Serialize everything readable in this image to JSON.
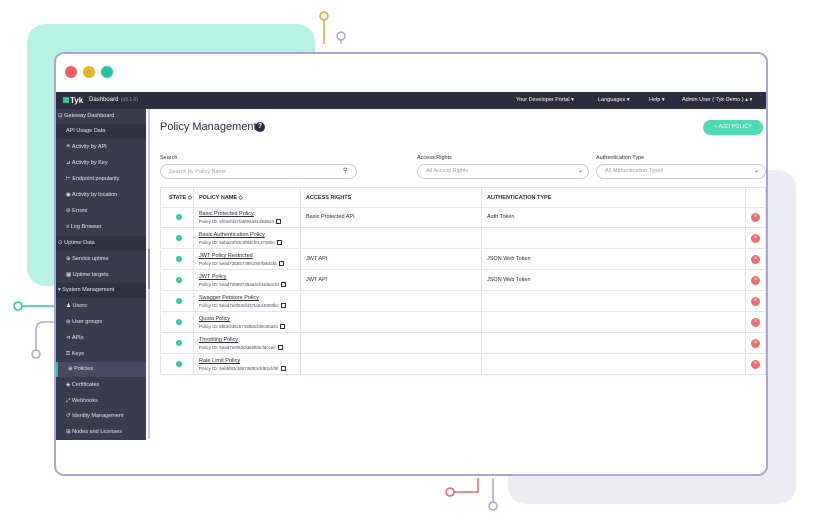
{
  "topbar": {
    "logo": "Tyk",
    "app_name": "Dashboard",
    "version": "(v3.1.0)",
    "nav": [
      "Your Developer Portal ▾",
      "Languages ▾",
      "Help ▾",
      "Admin User ( Tyk Demo ) ▴ ▾"
    ]
  },
  "sidebar": {
    "items": [
      {
        "label": "⊡ Gateway Dashboard"
      },
      {
        "label": "API Usage Data"
      },
      {
        "label": "≗ Activity by API"
      },
      {
        "label": "⊿ Activity by Key"
      },
      {
        "label": "⊢ Endpoint popularity"
      },
      {
        "label": "◉ Activity by location"
      },
      {
        "label": "⊘ Errors"
      },
      {
        "label": "≡ Log Browser"
      },
      {
        "label": "⊙ Uptime Data"
      },
      {
        "label": "⊕ Service uptime"
      },
      {
        "label": "▦ Uptime targets"
      },
      {
        "label": "▾ System Management"
      },
      {
        "label": "♟ Users"
      },
      {
        "label": "⊛ User groups"
      },
      {
        "label": "⊲ APIs"
      },
      {
        "label": "⚿ Keys"
      },
      {
        "label": "⊕ Policies"
      },
      {
        "label": "◈ Certificates"
      },
      {
        "label": "⤢ Webhooks"
      },
      {
        "label": "↺ Identity Management"
      },
      {
        "label": "⊞ Nodes and Licenses"
      }
    ]
  },
  "main": {
    "title": "Policy Management",
    "help": "?",
    "add_button": "+ ADD POLICY",
    "filters": {
      "search_label": "Search",
      "search_placeholder": "Search by Policy Name",
      "access_label": "Access Rights",
      "access_value": "All Access Rights",
      "auth_label": "Authentication Type",
      "auth_value": "All Authentication Types"
    },
    "table": {
      "headers": [
        "STATE ◇",
        "POLICY NAME ◇",
        "ACCESS RIGHTS",
        "AUTHENTICATION TYPE"
      ],
      "rows": [
        {
          "name": "Basic Protected Policy",
          "id": "Policy ID: 5f03cfd37fa5f92a91d5d824",
          "rights": "Basic Protected API",
          "auth": "Auth Token"
        },
        {
          "name": "Basic Authentication Policy",
          "id": "Policy ID: 5eba22f83c0f83cf0137385c",
          "rights": "",
          "auth": ""
        },
        {
          "name": "JWT Policy Restricted",
          "id": "Policy ID: 5ead7356573961000fa63cfd",
          "rights": "JWT API",
          "auth": "JSON Web Token"
        },
        {
          "name": "JWT Policy",
          "id": "Policy ID: 5ead72955735aa3cfd4d63cfd",
          "rights": "JWT API",
          "auth": "JSON Web Token"
        },
        {
          "name": "Swagger Petstore Policy",
          "id": "Policy ID: 5ead7e5f83cfd37fa5d4000fbc",
          "rights": "",
          "auth": ""
        },
        {
          "name": "Quota Policy",
          "id": "Policy ID: 5f83cfd5c5735f83cfd8c8ba81",
          "rights": "",
          "auth": ""
        },
        {
          "name": "Throttling Policy",
          "id": "Policy ID: 5ead7e5f83cfde5f83cfdccee",
          "rights": "",
          "auth": ""
        },
        {
          "name": "Rate Limit Policy",
          "id": "Policy ID: 5eb5f83cfd5735f83cfd83cfd5f",
          "rights": "",
          "auth": ""
        }
      ]
    }
  },
  "colors": {
    "accent": "#22c7a0",
    "navbar": "#2b2c3c",
    "sidebar": "#393b4f",
    "delete": "#f06c6c",
    "mint_bg": "#b6f3e3",
    "window_border": "#a9a6d6"
  }
}
